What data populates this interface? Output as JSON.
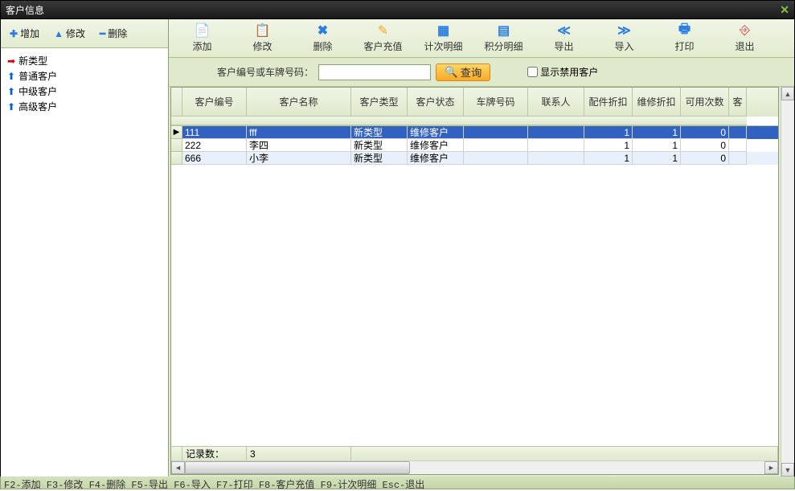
{
  "titlebar": {
    "title": "客户信息"
  },
  "sidebar": {
    "toolbar": {
      "add": "增加",
      "edit": "修改",
      "del": "删除"
    },
    "tree": [
      {
        "label": "新类型",
        "icon": "arrow-right-red",
        "selected": true
      },
      {
        "label": "普通客户",
        "icon": "arrow-up-blue"
      },
      {
        "label": "中级客户",
        "icon": "arrow-up-blue"
      },
      {
        "label": "高级客户",
        "icon": "arrow-up-blue"
      }
    ]
  },
  "main_toolbar": [
    {
      "name": "add",
      "label": "添加",
      "icon": "📄",
      "cls": "ic-blue"
    },
    {
      "name": "edit",
      "label": "修改",
      "icon": "📋",
      "cls": "ic-orange"
    },
    {
      "name": "delete",
      "label": "删除",
      "icon": "✖",
      "cls": "ic-blue"
    },
    {
      "name": "recharge",
      "label": "客户充值",
      "icon": "✎",
      "cls": "ic-orange"
    },
    {
      "name": "count-detail",
      "label": "计次明细",
      "icon": "▦",
      "cls": "ic-blue"
    },
    {
      "name": "points-detail",
      "label": "积分明细",
      "icon": "▤",
      "cls": "ic-blue"
    },
    {
      "name": "export",
      "label": "导出",
      "icon": "≪",
      "cls": "ic-blue"
    },
    {
      "name": "import",
      "label": "导入",
      "icon": "≫",
      "cls": "ic-blue"
    },
    {
      "name": "print",
      "label": "打印",
      "icon": "🖶",
      "cls": "ic-blue"
    },
    {
      "name": "exit",
      "label": "退出",
      "icon": "⎆",
      "cls": "ic-red"
    }
  ],
  "search": {
    "label": "客户编号或车牌号码：",
    "value": "",
    "button": "查询",
    "checkbox": "显示禁用客户"
  },
  "grid": {
    "columns": [
      "客户编号",
      "客户名称",
      "客户类型",
      "客户状态",
      "车牌号码",
      "联系人",
      "配件折扣",
      "维修折扣",
      "可用次数",
      "客"
    ],
    "rows": [
      {
        "sel": true,
        "cells": [
          "111",
          "fff",
          "新类型",
          "维修客户",
          "",
          "",
          "1",
          "1",
          "0"
        ]
      },
      {
        "sel": false,
        "cells": [
          "222",
          "李四",
          "新类型",
          "维修客户",
          "",
          "",
          "1",
          "1",
          "0"
        ]
      },
      {
        "sel": false,
        "cells": [
          "666",
          "小李",
          "新类型",
          "维修客户",
          "",
          "",
          "1",
          "1",
          "0"
        ]
      }
    ],
    "footer": {
      "label": "记录数：",
      "value": "3"
    }
  },
  "statusbar": "F2-添加 F3-修改 F4-删除 F5-导出 F6-导入 F7-打印 F8-客户充值 F9-计次明细 Esc-退出"
}
